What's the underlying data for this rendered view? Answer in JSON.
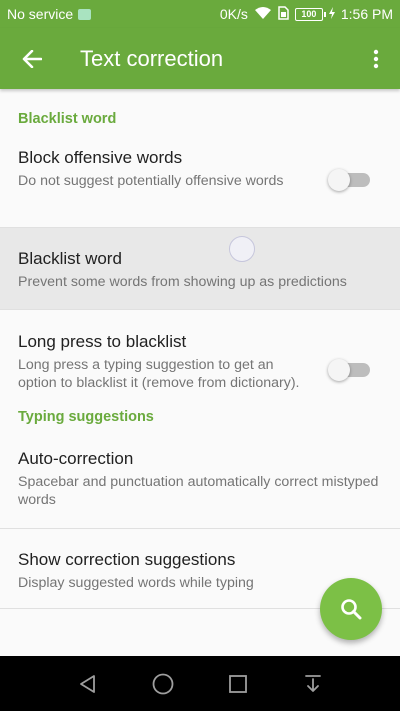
{
  "status_bar": {
    "carrier": "No service",
    "speed": "0K/s",
    "battery": "100",
    "time": "1:56 PM"
  },
  "app_bar": {
    "title": "Text correction",
    "back_icon": "arrow-back-icon",
    "menu_icon": "more-vert-icon"
  },
  "sections": {
    "blacklist_header": "Blacklist word",
    "typing_header": "Typing suggestions"
  },
  "prefs": {
    "block_offensive": {
      "title": "Block offensive words",
      "summary": "Do not suggest potentially offensive words",
      "enabled": false
    },
    "blacklist_word": {
      "title": "Blacklist word",
      "summary": "Prevent some words from showing up as predictions"
    },
    "long_press": {
      "title": "Long press to blacklist",
      "summary": "Long press a typing suggestion to get an option to blacklist it (remove from dictionary).",
      "enabled": false
    },
    "auto_correction": {
      "title": "Auto-correction",
      "summary": "Spacebar and punctuation automatically correct mistyped words"
    },
    "show_suggestions": {
      "title": "Show correction suggestions",
      "summary": "Display suggested words while typing"
    }
  },
  "fab": {
    "icon": "search-icon"
  },
  "colors": {
    "primary": "#6aaa3d",
    "accent": "#7cc046"
  }
}
